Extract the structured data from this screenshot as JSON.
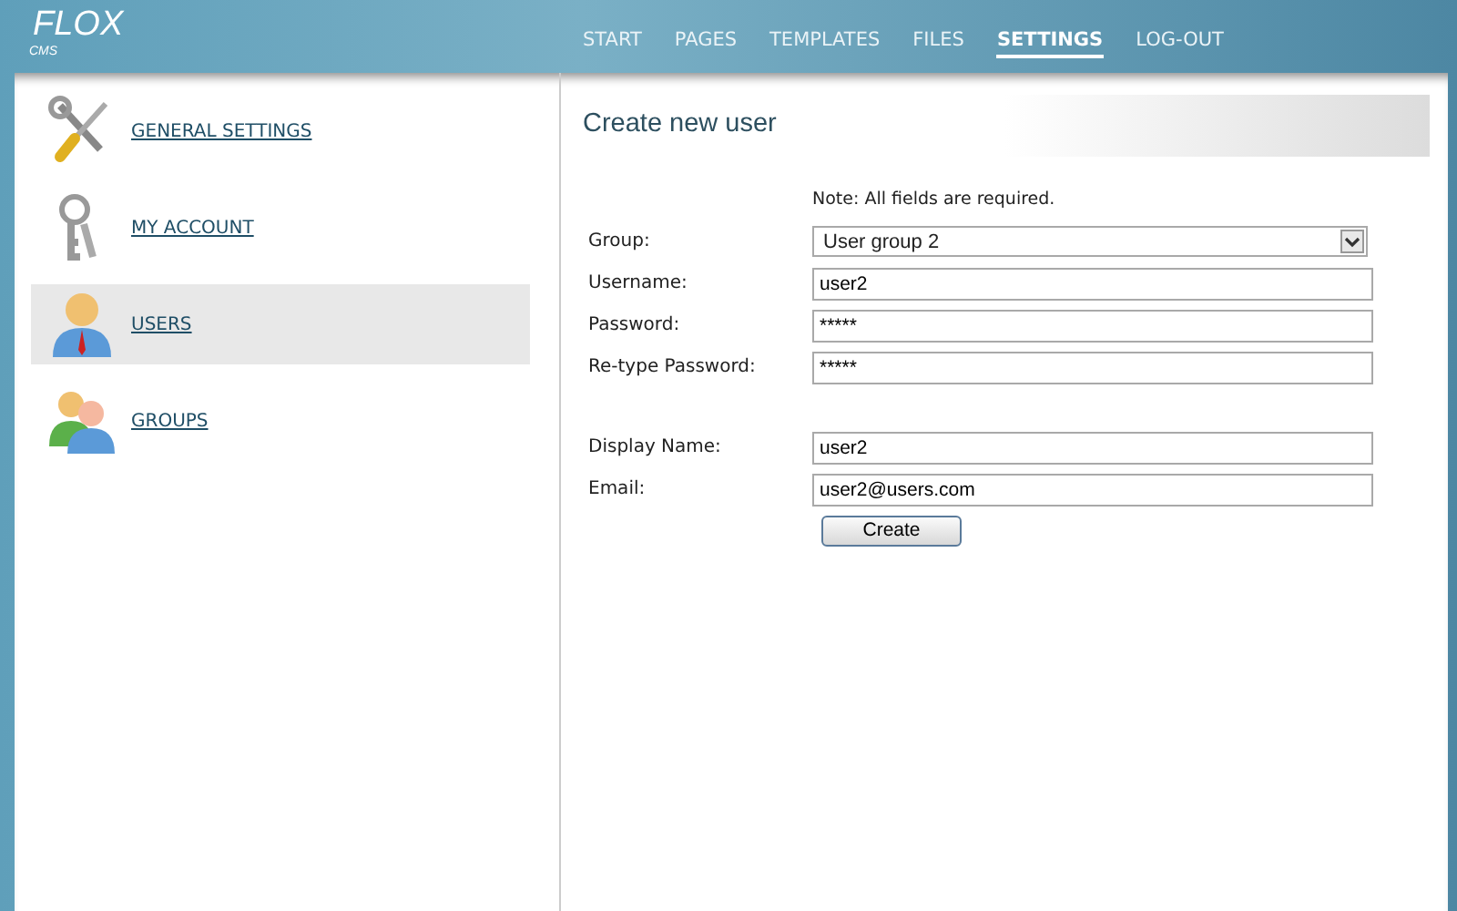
{
  "logo": {
    "name": "FLOX",
    "sub": "CMS"
  },
  "nav": [
    {
      "label": "START",
      "selected": false
    },
    {
      "label": "PAGES",
      "selected": false
    },
    {
      "label": "TEMPLATES",
      "selected": false
    },
    {
      "label": "FILES",
      "selected": false
    },
    {
      "label": "SETTINGS",
      "selected": true
    },
    {
      "label": "LOG-OUT",
      "selected": false
    }
  ],
  "sidebar": {
    "items": [
      {
        "label": "GENERAL SETTINGS",
        "selected": false
      },
      {
        "label": "MY ACCOUNT",
        "selected": false
      },
      {
        "label": "USERS",
        "selected": true
      },
      {
        "label": "GROUPS",
        "selected": false
      }
    ]
  },
  "form": {
    "title": "Create new user",
    "note": "Note: All fields are required.",
    "field_groups": [
      [
        {
          "label": "Group:",
          "kind": "select",
          "value": "User group 2"
        },
        {
          "label": "Username:",
          "kind": "text",
          "value": "user2"
        },
        {
          "label": "Password:",
          "kind": "text",
          "value": "*****"
        },
        {
          "label": "Re-type Password:",
          "kind": "text",
          "value": "*****"
        }
      ],
      [
        {
          "label": "Display Name:",
          "kind": "text",
          "value": "user2"
        },
        {
          "label": "Email:",
          "kind": "text",
          "value": "user2@users.com"
        }
      ]
    ],
    "submit": "Create"
  }
}
